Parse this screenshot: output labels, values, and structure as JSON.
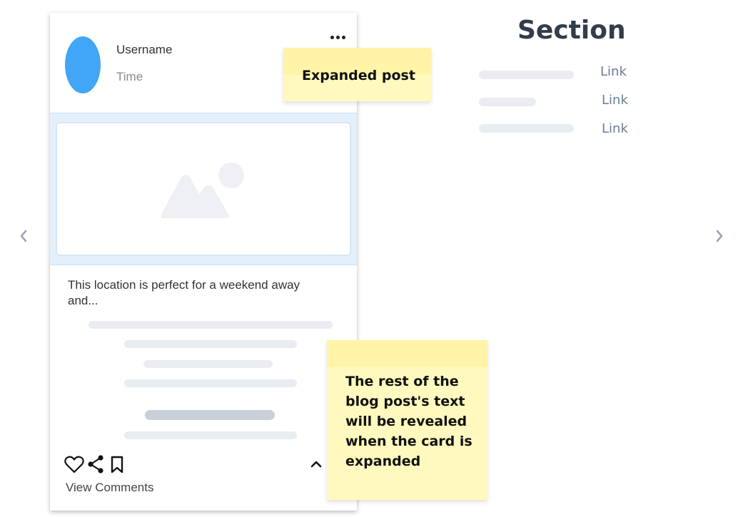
{
  "post": {
    "username": "Username",
    "time": "Time",
    "excerpt": "This location is perfect for a weekend away and...",
    "view_comments": "View Comments"
  },
  "sticky_notes": {
    "expanded": "Expanded post",
    "reveal": "The rest of the blog post's text will be revealed when the card is expanded"
  },
  "section": {
    "title": "Section",
    "links": [
      "Link",
      "Link",
      "Link"
    ]
  },
  "colors": {
    "avatar": "#41a6f5",
    "sticky": "#fff9bf",
    "link": "#6b7d99",
    "media_band": "#e3f0fb"
  },
  "icons": {
    "more": "more-horizontal-icon",
    "image": "image-placeholder-icon",
    "like": "heart-icon",
    "share": "share-icon",
    "save": "bookmark-icon",
    "collapse": "chevron-up-icon",
    "prev": "chevron-left-icon",
    "next": "chevron-right-icon"
  }
}
